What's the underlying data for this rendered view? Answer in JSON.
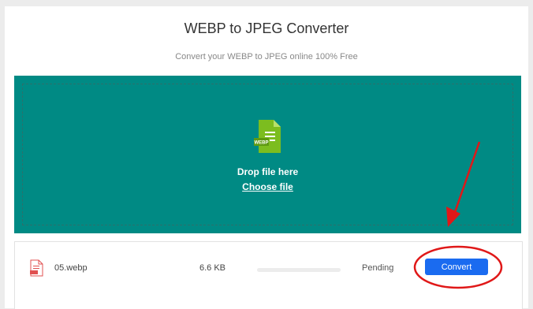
{
  "header": {
    "title": "WEBP to JPEG Converter",
    "subtitle": "Convert your WEBP to JPEG online 100% Free"
  },
  "dropzone": {
    "file_type_badge": "WEBP",
    "drop_text": "Drop file here",
    "choose_label": "Choose file"
  },
  "file_row": {
    "name": "05.webp",
    "size": "6.6 KB",
    "progress_percent": 0,
    "status": "Pending",
    "convert_label": "Convert"
  },
  "colors": {
    "dropzone_bg": "#008a84",
    "file_icon": "#7cbd1f",
    "button": "#1a6bf0",
    "annotation": "#e01818"
  },
  "icons": {
    "file_type_icon": "webp-file-icon",
    "row_file_icon": "red-file-icon"
  }
}
